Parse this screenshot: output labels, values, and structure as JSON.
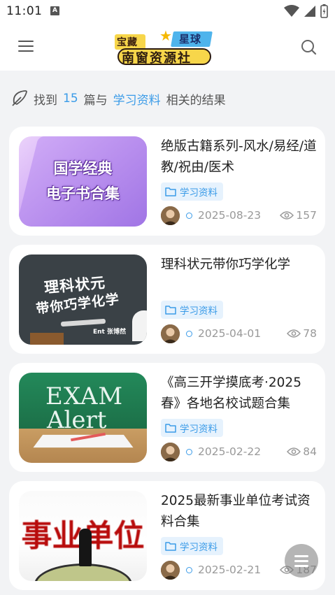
{
  "status_bar": {
    "time": "11:01",
    "indicator": "A"
  },
  "header": {
    "logo": {
      "top_left": "宝藏",
      "top_right": "星球",
      "main": "南窗资源社"
    }
  },
  "search_summary": {
    "prefix": "找到",
    "count": "15",
    "middle": "篇与",
    "keyword": "学习资料",
    "suffix": "相关的结果"
  },
  "articles": [
    {
      "title": "绝版古籍系列-风水/易经/道教/祝由/医术",
      "thumb_lines": [
        "国学经典",
        "电子书合集"
      ],
      "tag": "学习资料",
      "date": "2025-08-23",
      "views": "157"
    },
    {
      "title": "理科状元带你巧学化学",
      "thumb_lines": [
        "理科状元",
        "带你巧学化学",
        "Ent 张博然"
      ],
      "tag": "学习资料",
      "date": "2025-04-01",
      "views": "78"
    },
    {
      "title": "《高三开学摸底考·2025春》各地名校试题合集",
      "thumb_lines": [
        "EXAM",
        "Alert"
      ],
      "tag": "学习资料",
      "date": "2025-02-22",
      "views": "84"
    },
    {
      "title": "2025最新事业单位考试资料合集",
      "thumb_lines": [
        "事业单位"
      ],
      "tag": "学习资料",
      "date": "2025-02-21",
      "views": "187"
    }
  ],
  "colors": {
    "accent": "#3a9be8",
    "tag_bg": "#e6f2fd",
    "page_bg": "#f2f3f5"
  }
}
